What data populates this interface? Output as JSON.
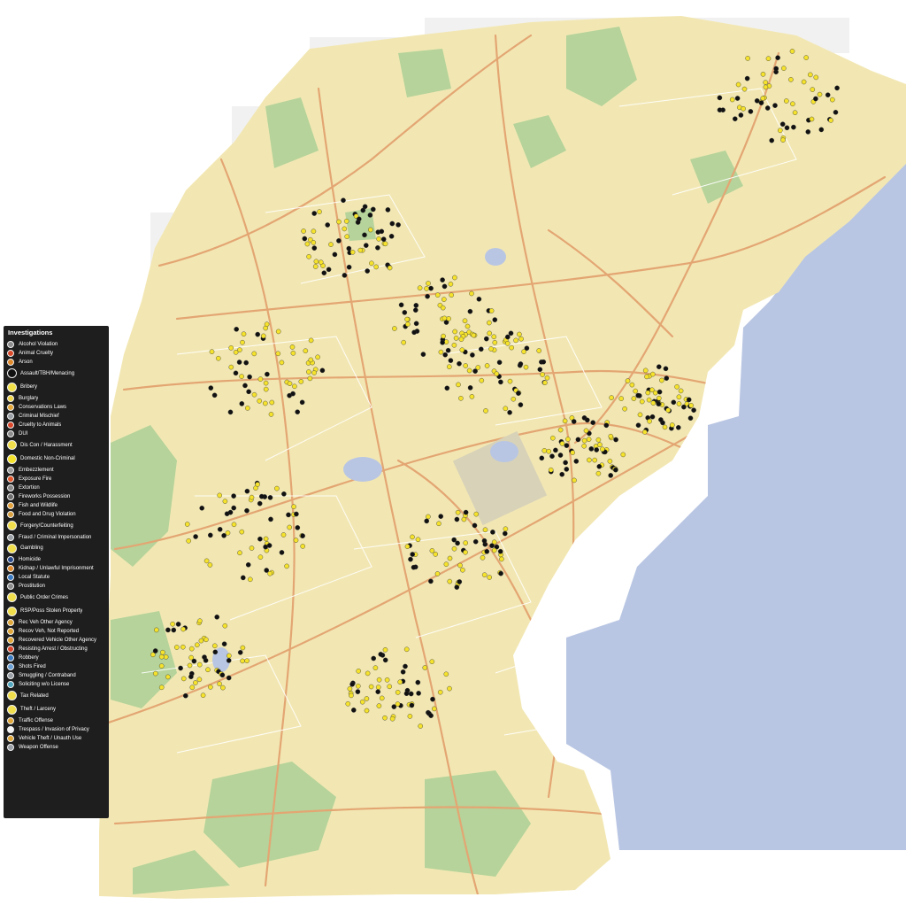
{
  "map": {
    "colors": {
      "land": "#f2e7b3",
      "water": "#b9c6e3",
      "park": "#b5d39a",
      "road_major": "#e3a673",
      "road_minor": "#ffffff",
      "outside": "#f1f1f1",
      "pin_fill": "#f5e22c",
      "pin_dark": "#111111"
    }
  },
  "legend": {
    "title": "Investigations",
    "items": [
      {
        "label": "Alcohol Violation",
        "color": "#8c8c8c",
        "size": "small",
        "icon": "alcohol-icon"
      },
      {
        "label": "Animal Cruelty",
        "color": "#d94a2a",
        "size": "small",
        "icon": "animal-icon"
      },
      {
        "label": "Arson",
        "color": "#e0892b",
        "size": "small",
        "icon": "fire-icon"
      },
      {
        "label": "Assault/TBH/Menacing",
        "color": "#111111",
        "size": "tall",
        "icon": "fist-icon"
      },
      {
        "label": "Bribery",
        "color": "#f3e14a",
        "size": "tall",
        "icon": "money-icon"
      },
      {
        "label": "Burglary",
        "color": "#f0d64a",
        "size": "small",
        "icon": "house-icon"
      },
      {
        "label": "Conservations Laws",
        "color": "#e5a83a",
        "size": "small",
        "icon": "leaf-icon"
      },
      {
        "label": "Criminal Mischief",
        "color": "#9aa0a6",
        "size": "small",
        "icon": "spray-icon"
      },
      {
        "label": "Cruelty to Animals",
        "color": "#d9462a",
        "size": "small",
        "icon": "paw-icon"
      },
      {
        "label": "DUI",
        "color": "#8c8c8c",
        "size": "small",
        "icon": "car-icon"
      },
      {
        "label": "Dis Con / Harassment",
        "color": "#f1de4d",
        "size": "tall",
        "icon": "speech-icon"
      },
      {
        "label": "Domestic Non-Criminal",
        "color": "#f5e22c",
        "size": "tall",
        "icon": "family-icon"
      },
      {
        "label": "Embezzlement",
        "color": "#9a9a9a",
        "size": "small",
        "icon": "briefcase-icon"
      },
      {
        "label": "Exposure Fire",
        "color": "#e2572b",
        "size": "small",
        "icon": "flame-icon"
      },
      {
        "label": "Extortion",
        "color": "#8a8a8a",
        "size": "small",
        "icon": "hand-icon"
      },
      {
        "label": "Fireworks Possession",
        "color": "#6e6e6e",
        "size": "small",
        "icon": "firework-icon"
      },
      {
        "label": "Fish and Wildlife",
        "color": "#e3a23c",
        "size": "small",
        "icon": "fish-icon"
      },
      {
        "label": "Food and Drug Violation",
        "color": "#d9a040",
        "size": "small",
        "icon": "pill-icon"
      },
      {
        "label": "Forgery/Counterfeiting",
        "color": "#f1de4d",
        "size": "tall",
        "icon": "pen-icon"
      },
      {
        "label": "Fraud / Criminal Impersonation",
        "color": "#9aa0a6",
        "size": "small",
        "icon": "mask-icon"
      },
      {
        "label": "Gambling",
        "color": "#f1de4d",
        "size": "tall",
        "icon": "dice-icon"
      },
      {
        "label": "Homicide",
        "color": "#2a4a8a",
        "size": "small",
        "icon": "knife-icon"
      },
      {
        "label": "Kidnap / Unlawful Imprisonment",
        "color": "#e0892b",
        "size": "small",
        "icon": "lock-icon"
      },
      {
        "label": "Local Statute",
        "color": "#3a7ac2",
        "size": "small",
        "icon": "building-icon"
      },
      {
        "label": "Prostitution",
        "color": "#8c8c8c",
        "size": "small",
        "icon": "person-icon"
      },
      {
        "label": "Public Order Crimes",
        "color": "#f1de4d",
        "size": "tall",
        "icon": "pillar-icon"
      },
      {
        "label": "RSP/Poss Stolen Property",
        "color": "#f1de4d",
        "size": "tall",
        "icon": "box-icon"
      },
      {
        "label": "Rec Veh Other Agency",
        "color": "#e0a83a",
        "size": "small",
        "icon": "truck-icon"
      },
      {
        "label": "Recov Veh, Not Reported",
        "color": "#e0a83a",
        "size": "small",
        "icon": "truck-icon"
      },
      {
        "label": "Recovered Vehicle Other Agency",
        "color": "#e0a83a",
        "size": "small",
        "icon": "truck-icon"
      },
      {
        "label": "Resisting Arrest / Obstructing",
        "color": "#d9462a",
        "size": "small",
        "icon": "handcuff-icon"
      },
      {
        "label": "Robbery",
        "color": "#3a7ac2",
        "size": "small",
        "icon": "mask-icon"
      },
      {
        "label": "Shots Fired",
        "color": "#6aa0d6",
        "size": "small",
        "icon": "gun-icon"
      },
      {
        "label": "Smuggling / Contraband",
        "color": "#9aa0a6",
        "size": "small",
        "icon": "package-icon"
      },
      {
        "label": "Soliciting w/o License",
        "color": "#52a8c0",
        "size": "small",
        "icon": "badge-icon"
      },
      {
        "label": "Tax Related",
        "color": "#f1de4d",
        "size": "tall",
        "icon": "tax-icon"
      },
      {
        "label": "Theft / Larceny",
        "color": "#f1de4d",
        "size": "tall",
        "icon": "bag-icon"
      },
      {
        "label": "Traffic Offense",
        "color": "#e0a83a",
        "size": "small",
        "icon": "traffic-icon"
      },
      {
        "label": "Trespass / Invasion of Privacy",
        "color": "#f2f2f2",
        "size": "small",
        "icon": "eye-icon"
      },
      {
        "label": "Vehicle Theft / Unauth Use",
        "color": "#e0a83a",
        "size": "small",
        "icon": "key-icon"
      },
      {
        "label": "Weapon Offense",
        "color": "#9aa0a6",
        "size": "small",
        "icon": "weapon-icon"
      }
    ]
  }
}
